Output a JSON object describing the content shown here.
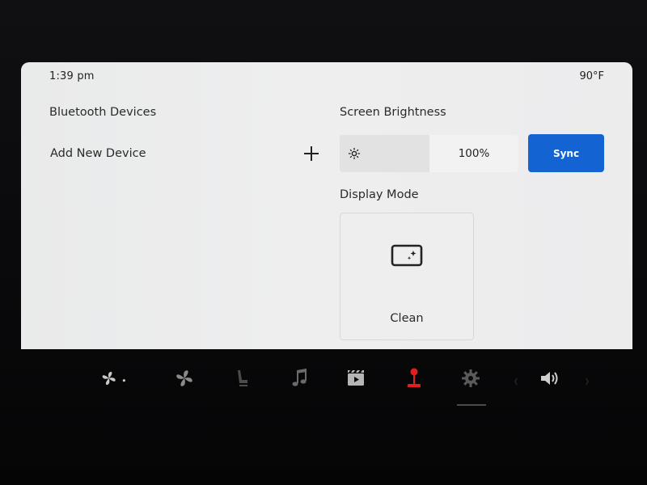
{
  "status": {
    "time": "1:39 pm",
    "temperature": "90°F"
  },
  "bluetooth": {
    "title": "Bluetooth Devices",
    "add_label": "Add New Device"
  },
  "brightness": {
    "title": "Screen Brightness",
    "value_text": "100%",
    "level": 1.0,
    "sync_label": "Sync"
  },
  "display_mode": {
    "title": "Display Mode",
    "selected_label": "Clean"
  },
  "colors": {
    "accent": "#1463d2",
    "screen_bg": "#ededee",
    "game_icon_red": "#e0201f"
  },
  "dock": {
    "items": [
      {
        "icon": "fan-low-icon"
      },
      {
        "icon": "fan-icon"
      },
      {
        "icon": "seat-heater-icon"
      },
      {
        "icon": "music-icon"
      },
      {
        "icon": "video-icon"
      },
      {
        "icon": "joystick-icon"
      },
      {
        "icon": "settings-gear-icon"
      },
      {
        "icon": "volume-icon"
      }
    ]
  }
}
